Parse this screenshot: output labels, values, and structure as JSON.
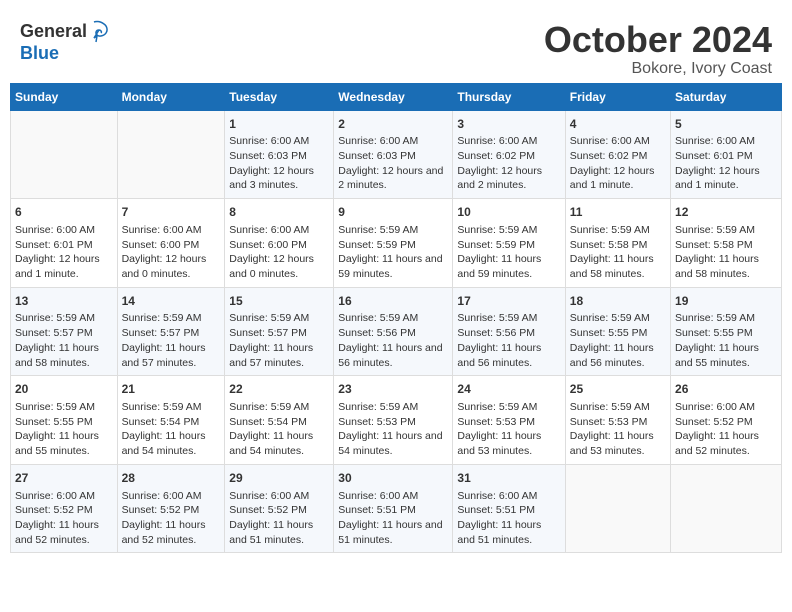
{
  "header": {
    "logo_general": "General",
    "logo_blue": "Blue",
    "month": "October 2024",
    "location": "Bokore, Ivory Coast"
  },
  "days_of_week": [
    "Sunday",
    "Monday",
    "Tuesday",
    "Wednesday",
    "Thursday",
    "Friday",
    "Saturday"
  ],
  "weeks": [
    [
      {
        "day": "",
        "info": ""
      },
      {
        "day": "",
        "info": ""
      },
      {
        "day": "1",
        "info": "Sunrise: 6:00 AM\nSunset: 6:03 PM\nDaylight: 12 hours and 3 minutes."
      },
      {
        "day": "2",
        "info": "Sunrise: 6:00 AM\nSunset: 6:03 PM\nDaylight: 12 hours and 2 minutes."
      },
      {
        "day": "3",
        "info": "Sunrise: 6:00 AM\nSunset: 6:02 PM\nDaylight: 12 hours and 2 minutes."
      },
      {
        "day": "4",
        "info": "Sunrise: 6:00 AM\nSunset: 6:02 PM\nDaylight: 12 hours and 1 minute."
      },
      {
        "day": "5",
        "info": "Sunrise: 6:00 AM\nSunset: 6:01 PM\nDaylight: 12 hours and 1 minute."
      }
    ],
    [
      {
        "day": "6",
        "info": "Sunrise: 6:00 AM\nSunset: 6:01 PM\nDaylight: 12 hours and 1 minute."
      },
      {
        "day": "7",
        "info": "Sunrise: 6:00 AM\nSunset: 6:00 PM\nDaylight: 12 hours and 0 minutes."
      },
      {
        "day": "8",
        "info": "Sunrise: 6:00 AM\nSunset: 6:00 PM\nDaylight: 12 hours and 0 minutes."
      },
      {
        "day": "9",
        "info": "Sunrise: 5:59 AM\nSunset: 5:59 PM\nDaylight: 11 hours and 59 minutes."
      },
      {
        "day": "10",
        "info": "Sunrise: 5:59 AM\nSunset: 5:59 PM\nDaylight: 11 hours and 59 minutes."
      },
      {
        "day": "11",
        "info": "Sunrise: 5:59 AM\nSunset: 5:58 PM\nDaylight: 11 hours and 58 minutes."
      },
      {
        "day": "12",
        "info": "Sunrise: 5:59 AM\nSunset: 5:58 PM\nDaylight: 11 hours and 58 minutes."
      }
    ],
    [
      {
        "day": "13",
        "info": "Sunrise: 5:59 AM\nSunset: 5:57 PM\nDaylight: 11 hours and 58 minutes."
      },
      {
        "day": "14",
        "info": "Sunrise: 5:59 AM\nSunset: 5:57 PM\nDaylight: 11 hours and 57 minutes."
      },
      {
        "day": "15",
        "info": "Sunrise: 5:59 AM\nSunset: 5:57 PM\nDaylight: 11 hours and 57 minutes."
      },
      {
        "day": "16",
        "info": "Sunrise: 5:59 AM\nSunset: 5:56 PM\nDaylight: 11 hours and 56 minutes."
      },
      {
        "day": "17",
        "info": "Sunrise: 5:59 AM\nSunset: 5:56 PM\nDaylight: 11 hours and 56 minutes."
      },
      {
        "day": "18",
        "info": "Sunrise: 5:59 AM\nSunset: 5:55 PM\nDaylight: 11 hours and 56 minutes."
      },
      {
        "day": "19",
        "info": "Sunrise: 5:59 AM\nSunset: 5:55 PM\nDaylight: 11 hours and 55 minutes."
      }
    ],
    [
      {
        "day": "20",
        "info": "Sunrise: 5:59 AM\nSunset: 5:55 PM\nDaylight: 11 hours and 55 minutes."
      },
      {
        "day": "21",
        "info": "Sunrise: 5:59 AM\nSunset: 5:54 PM\nDaylight: 11 hours and 54 minutes."
      },
      {
        "day": "22",
        "info": "Sunrise: 5:59 AM\nSunset: 5:54 PM\nDaylight: 11 hours and 54 minutes."
      },
      {
        "day": "23",
        "info": "Sunrise: 5:59 AM\nSunset: 5:53 PM\nDaylight: 11 hours and 54 minutes."
      },
      {
        "day": "24",
        "info": "Sunrise: 5:59 AM\nSunset: 5:53 PM\nDaylight: 11 hours and 53 minutes."
      },
      {
        "day": "25",
        "info": "Sunrise: 5:59 AM\nSunset: 5:53 PM\nDaylight: 11 hours and 53 minutes."
      },
      {
        "day": "26",
        "info": "Sunrise: 6:00 AM\nSunset: 5:52 PM\nDaylight: 11 hours and 52 minutes."
      }
    ],
    [
      {
        "day": "27",
        "info": "Sunrise: 6:00 AM\nSunset: 5:52 PM\nDaylight: 11 hours and 52 minutes."
      },
      {
        "day": "28",
        "info": "Sunrise: 6:00 AM\nSunset: 5:52 PM\nDaylight: 11 hours and 52 minutes."
      },
      {
        "day": "29",
        "info": "Sunrise: 6:00 AM\nSunset: 5:52 PM\nDaylight: 11 hours and 51 minutes."
      },
      {
        "day": "30",
        "info": "Sunrise: 6:00 AM\nSunset: 5:51 PM\nDaylight: 11 hours and 51 minutes."
      },
      {
        "day": "31",
        "info": "Sunrise: 6:00 AM\nSunset: 5:51 PM\nDaylight: 11 hours and 51 minutes."
      },
      {
        "day": "",
        "info": ""
      },
      {
        "day": "",
        "info": ""
      }
    ]
  ]
}
